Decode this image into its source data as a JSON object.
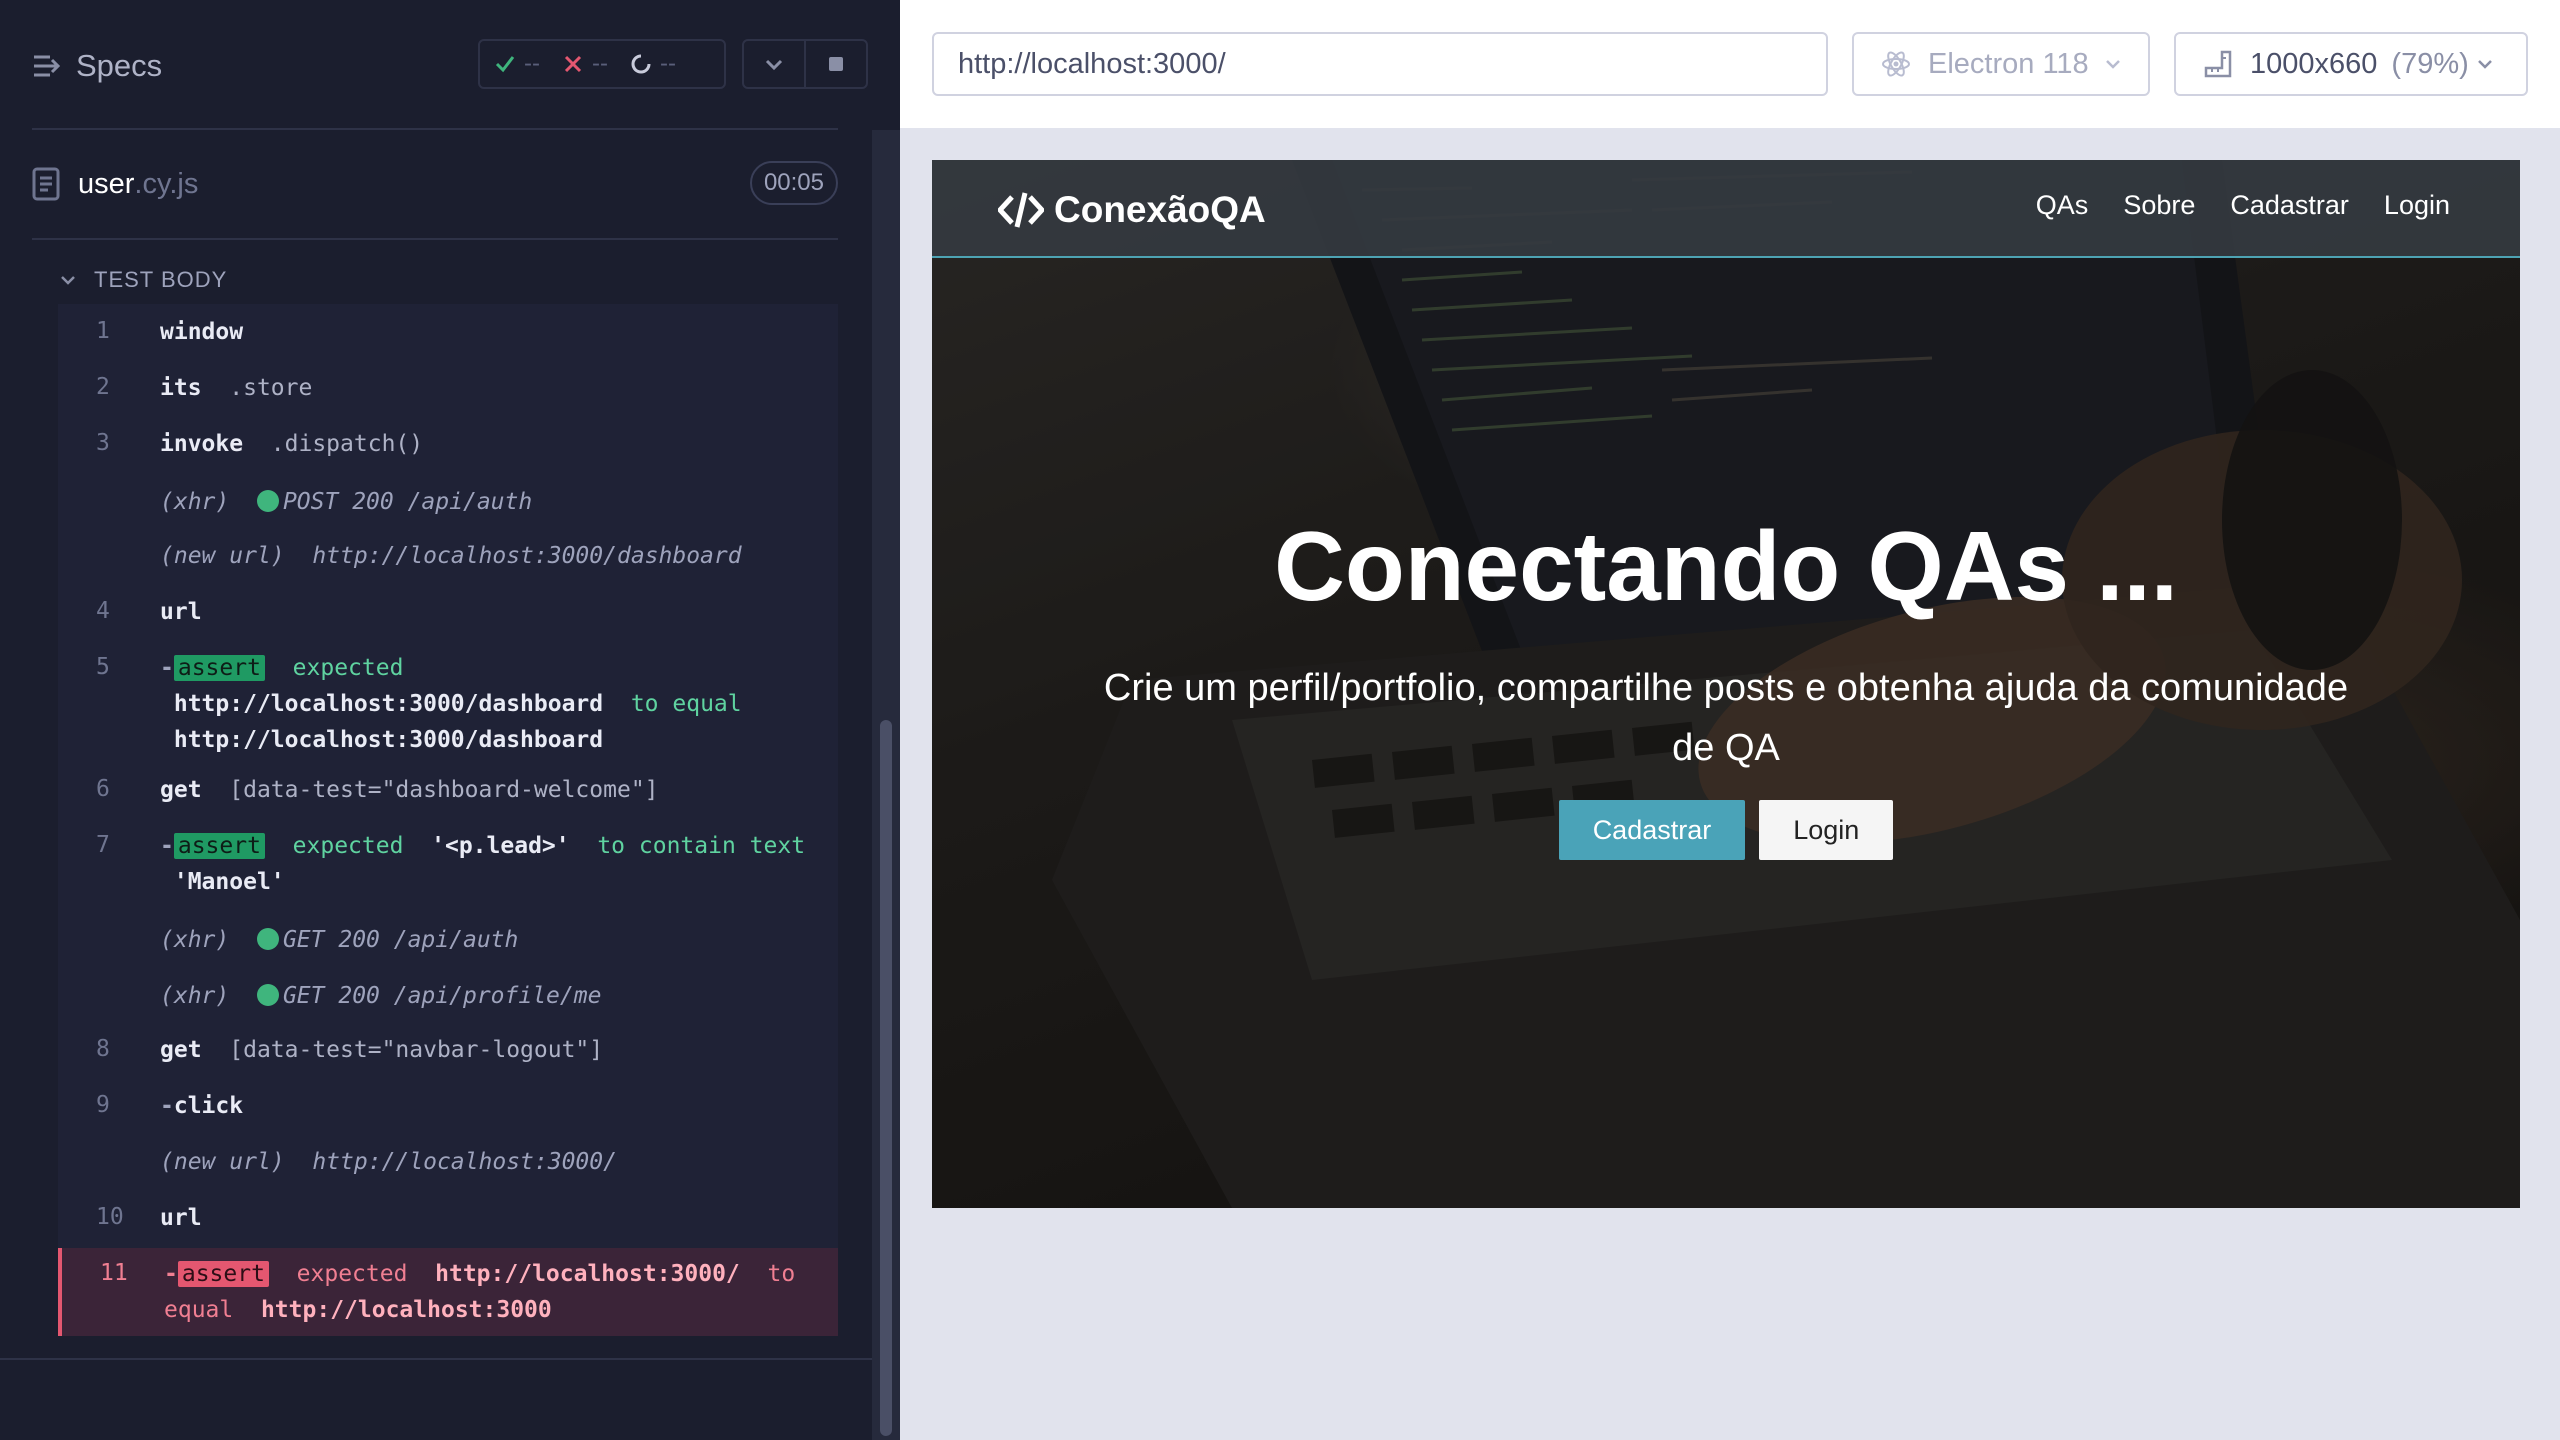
{
  "reporter": {
    "specs_label": "Specs",
    "stats": {
      "passed": "--",
      "failed": "--",
      "pending": "--"
    },
    "spec_file": {
      "name": "user",
      "ext": ".cy.js",
      "duration": "00:05"
    },
    "test_body_label": "TEST BODY",
    "commands": [
      {
        "num": "1",
        "name": "window",
        "msg": ""
      },
      {
        "num": "2",
        "name": "its",
        "msg": ".store"
      },
      {
        "num": "3",
        "name": "invoke",
        "msg": ".dispatch()"
      },
      {
        "xhr": "(xhr)",
        "text": "POST 200 /api/auth"
      },
      {
        "newurl": "(new url)",
        "url": "http://localhost:3000/dashboard"
      },
      {
        "num": "4",
        "name": "url",
        "msg": ""
      },
      {
        "num": "5",
        "badge": "assert",
        "t1": "expected",
        "v1": "http://localhost:3000/dashboard",
        "t2": "to equal",
        "v2": "http://localhost:3000/dashboard"
      },
      {
        "num": "6",
        "name": "get",
        "msg": "[data-test=\"dashboard-welcome\"]"
      },
      {
        "num": "7",
        "badge": "assert",
        "t1": "expected",
        "v1": "'<p.lead>'",
        "t2": "to contain text",
        "v2": "'Manoel'"
      },
      {
        "xhr": "(xhr)",
        "text": "GET 200 /api/auth"
      },
      {
        "xhr": "(xhr)",
        "text": "GET 200 /api/profile/me"
      },
      {
        "num": "8",
        "name": "get",
        "msg": "[data-test=\"navbar-logout\"]"
      },
      {
        "num": "9",
        "name": "click",
        "msg": ""
      },
      {
        "newurl": "(new url)",
        "url": "http://localhost:3000/"
      },
      {
        "num": "10",
        "name": "url",
        "msg": ""
      },
      {
        "num": "11",
        "badge": "assert",
        "t1": "expected",
        "v1": "http://localhost:3000/",
        "t2": "to",
        "t3": "equal",
        "v2": "http://localhost:3000"
      }
    ]
  },
  "aut": {
    "url": "http://localhost:3000/",
    "browser": "Electron 118",
    "viewport": "1000x660",
    "viewport_pct": "(79%)"
  },
  "app": {
    "brand": "ConexãoQA",
    "nav": [
      "QAs",
      "Sobre",
      "Cadastrar",
      "Login"
    ],
    "hero_title": "Conectando QAs ...",
    "hero_lead": "Crie um perfil/portfolio, compartilhe posts e obtenha ajuda da comunidade de QA",
    "btn_cadastrar": "Cadastrar",
    "btn_login": "Login"
  },
  "colors": {
    "reporter_bg": "#1b1e2e",
    "pass": "#1f9a63",
    "fail": "#e45770",
    "app_accent": "#4aa3b8"
  },
  "icons": [
    "specs-menu-icon",
    "pass-check-icon",
    "fail-x-icon",
    "pending-spinner-icon",
    "chevron-down-icon",
    "stop-icon",
    "spec-file-icon",
    "electron-icon",
    "viewport-ruler-icon",
    "code-brand-icon"
  ]
}
